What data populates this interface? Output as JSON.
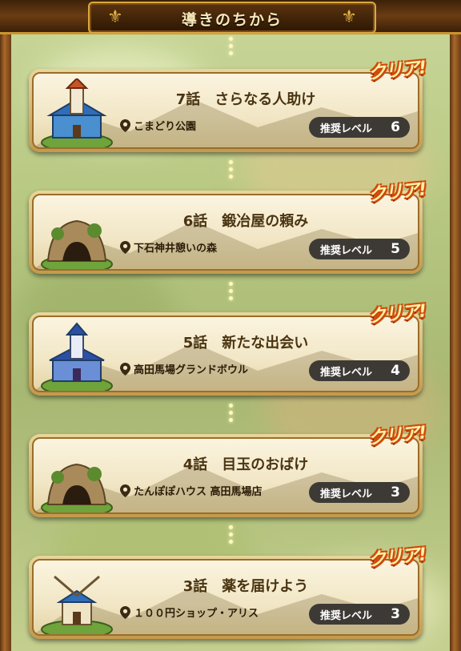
{
  "header": {
    "title": "導きのちから"
  },
  "quests": [
    {
      "title": "7話　さらなる人助け",
      "location": "こまどり公園",
      "level_label": "推奨レベル",
      "level": "6",
      "status": "クリア!",
      "icon": "castle-icon"
    },
    {
      "title": "6話　鍛冶屋の頼み",
      "location": "下石神井憩いの森",
      "level_label": "推奨レベル",
      "level": "5",
      "status": "クリア!",
      "icon": "cave-icon"
    },
    {
      "title": "5話　新たな出会い",
      "location": "高田馬場グランドボウル",
      "level_label": "推奨レベル",
      "level": "4",
      "status": "クリア!",
      "icon": "castle-icon"
    },
    {
      "title": "4話　目玉のおばけ",
      "location": "たんぽぽハウス 高田馬場店",
      "level_label": "推奨レベル",
      "level": "3",
      "status": "クリア!",
      "icon": "cave-icon"
    },
    {
      "title": "3話　薬を届けよう",
      "location": "１００円ショップ・アリス",
      "level_label": "推奨レベル",
      "level": "3",
      "status": "クリア!",
      "icon": "windmill-icon"
    }
  ]
}
